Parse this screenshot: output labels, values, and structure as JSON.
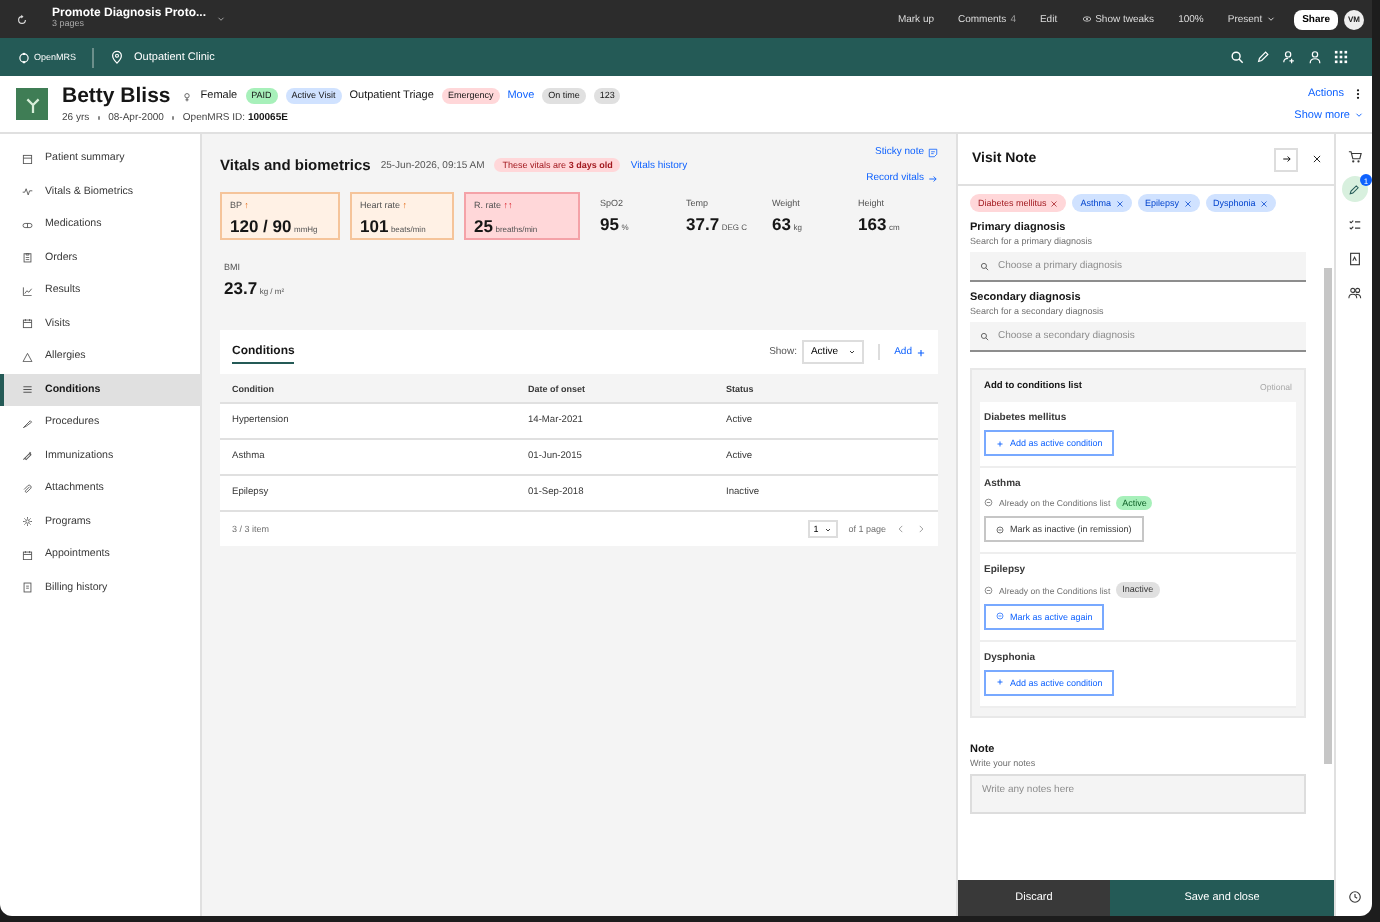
{
  "topbar": {
    "title": "Promote Diagnosis Proto...",
    "subtitle": "3 pages",
    "actions": [
      {
        "label": "Mark up"
      },
      {
        "label": "Comments",
        "count": "4"
      },
      {
        "label": "Edit"
      },
      {
        "label": "Show tweaks",
        "kind": "eye"
      },
      {
        "label": "100%"
      },
      {
        "label": "Present",
        "kind": "menu"
      }
    ],
    "share": "Share",
    "avatar": "VM"
  },
  "nav": {
    "logo": "OpenMRS",
    "location": "Outpatient Clinic"
  },
  "patient": {
    "name": "Betty Bliss",
    "age": "26 yrs",
    "dob": "08-Apr-2000",
    "id_label": "OpenMRS ID:",
    "id": "100065E",
    "actions": "Actions",
    "show_more": "Show more",
    "items": [
      {
        "kind": "gender",
        "label": "Female"
      },
      {
        "kind": "tag",
        "label": "PAID",
        "color": "#a7f0ba"
      },
      {
        "kind": "tag",
        "label": "Active Visit",
        "color": "#d0e2ff"
      },
      {
        "kind": "text",
        "label": "Outpatient Triage"
      },
      {
        "kind": "tag",
        "label": "Emergency",
        "color": "#ffd7d9"
      },
      {
        "kind": "link",
        "label": "Move"
      },
      {
        "kind": "tag",
        "label": "On time",
        "color": "#e0e0e0"
      },
      {
        "kind": "tag",
        "label": "123",
        "color": "#e0e0e0"
      }
    ]
  },
  "sidebar": {
    "items": [
      {
        "label": "Patient summary",
        "selected": false
      },
      {
        "label": "Vitals & Biometrics",
        "selected": false
      },
      {
        "label": "Medications",
        "selected": false
      },
      {
        "label": "Orders",
        "selected": false
      },
      {
        "label": "Results",
        "selected": false
      },
      {
        "label": "Visits",
        "selected": false
      },
      {
        "label": "Allergies",
        "selected": false
      },
      {
        "label": "Conditions",
        "selected": true
      },
      {
        "label": "Procedures",
        "selected": false
      },
      {
        "label": "Immunizations",
        "selected": false
      },
      {
        "label": "Attachments",
        "selected": false
      },
      {
        "label": "Programs",
        "selected": false
      },
      {
        "label": "Appointments",
        "selected": false
      },
      {
        "label": "Billing history",
        "selected": false
      }
    ]
  },
  "vitals": {
    "title": "Vitals and biometrics",
    "time": "25-Jun-2026, 09:15 AM",
    "alert": "These vitals are **3 days old**",
    "history": "Vitals history",
    "sticky": "Sticky note",
    "record": "Record vitals",
    "cards": [
      {
        "label": "BP",
        "flag": "↑",
        "value": "120 / 90",
        "unit": "mmHg",
        "kind": "warn"
      },
      {
        "label": "Heart rate",
        "flag": "↑",
        "value": "101",
        "unit": "beats/min",
        "kind": "warn"
      },
      {
        "label": "R. rate",
        "flag": "↑↑",
        "value": "25",
        "unit": "breaths/min",
        "kind": "danger"
      },
      {
        "label": "SpO2",
        "value": "95",
        "unit": "%",
        "kind": "plain"
      },
      {
        "label": "Temp",
        "value": "37.7",
        "unit": "DEG C",
        "kind": "plain"
      },
      {
        "label": "Weight",
        "value": "63",
        "unit": "kg",
        "kind": "plain"
      },
      {
        "label": "Height",
        "value": "163",
        "unit": "cm",
        "kind": "plain"
      },
      {
        "label": "BMI",
        "value": "23.7",
        "unit": "kg / m²",
        "kind": "plain"
      }
    ]
  },
  "conditions": {
    "title": "Conditions",
    "show_label": "Show:",
    "filter": "Active",
    "add": "Add",
    "columns": [
      "Condition",
      "Date of onset",
      "Status"
    ],
    "rows": [
      [
        "Hypertension",
        "14-Mar-2021",
        "Active"
      ],
      [
        "Asthma",
        "01-Jun-2015",
        "Active"
      ],
      [
        "Epilepsy",
        "01-Sep-2018",
        "Inactive"
      ]
    ],
    "count": "3 / 3 item",
    "page": "1",
    "pages": "of 1 page"
  },
  "visit_note": {
    "title": "Visit Note",
    "chips": [
      {
        "label": "Diabetes mellitus",
        "color": "#ffd7d9"
      },
      {
        "label": "Asthma",
        "color": "#d0e2ff"
      },
      {
        "label": "Epilepsy",
        "color": "#d0e2ff"
      },
      {
        "label": "Dysphonia",
        "color": "#d0e2ff"
      }
    ],
    "primary": {
      "label": "Primary diagnosis",
      "hint": "Search for a primary diagnosis",
      "placeholder": "Choose a primary diagnosis"
    },
    "secondary": {
      "label": "Secondary diagnosis",
      "hint": "Search for a secondary diagnosis",
      "placeholder": "Choose a secondary diagnosis"
    },
    "condition_list": {
      "title": "Add to conditions list",
      "optional": "Optional",
      "items": [
        {
          "name": "Diabetes mellitus",
          "kind": "new",
          "action": "Add as active condition"
        },
        {
          "name": "Asthma",
          "kind": "existing",
          "note": "Already on the Conditions list",
          "status": "Active",
          "active": true,
          "action": "Mark as inactive (in remission)"
        },
        {
          "name": "Epilepsy",
          "kind": "existing",
          "note": "Already on the Conditions list",
          "status": "Inactive",
          "active": false,
          "action": "Mark as active again"
        },
        {
          "name": "Dysphonia",
          "kind": "new",
          "action": "Add as active condition"
        }
      ]
    },
    "note": {
      "label": "Note",
      "hint": "Write your notes",
      "placeholder": "Write any notes here"
    },
    "discard": "Discard",
    "save": "Save and close"
  },
  "rail": {
    "badge": "1"
  }
}
